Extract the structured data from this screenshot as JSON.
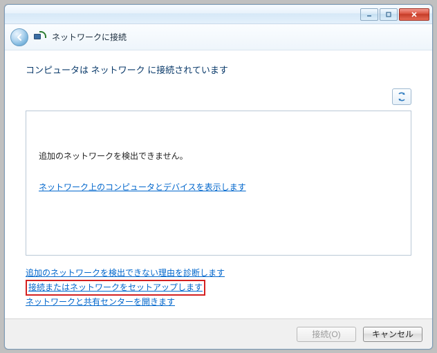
{
  "window": {
    "title": "ネットワークに接続"
  },
  "content": {
    "heading": "コンピュータは ネットワーク に接続されています",
    "status": "追加のネットワークを検出できません。",
    "link_show_devices": "ネットワーク上のコンピュータとデバイスを表示します"
  },
  "links": {
    "diagnose": "追加のネットワークを検出できない理由を診断します",
    "setup": "接続またはネットワークをセットアップします",
    "sharing_center": "ネットワークと共有センターを開きます"
  },
  "footer": {
    "connect": "接続(O)",
    "cancel": "キャンセル"
  }
}
